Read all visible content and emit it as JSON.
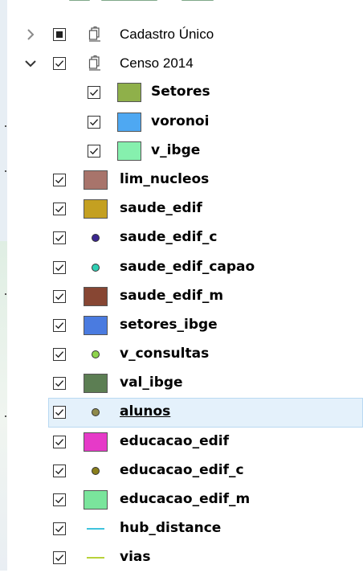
{
  "layers_panel": {
    "items": [
      {
        "kind": "group",
        "label": "Cadastro Único",
        "expanded": false,
        "checked": "partial",
        "icon": "layer-group-icon"
      },
      {
        "kind": "group",
        "label": "Censo 2014",
        "expanded": true,
        "checked": "checked",
        "icon": "layer-group-icon"
      },
      {
        "kind": "polygon",
        "label": "Setores",
        "color": "#8fb04a",
        "child": true
      },
      {
        "kind": "polygon",
        "label": "voronoi",
        "color": "#4ea8f2",
        "child": true
      },
      {
        "kind": "polygon",
        "label": "v_ibge",
        "color": "#86f0ae",
        "child": true
      },
      {
        "kind": "polygon",
        "label": "lim_nucleos",
        "color": "#a8746b"
      },
      {
        "kind": "polygon",
        "label": "saude_edif",
        "color": "#c4a021"
      },
      {
        "kind": "point",
        "label": "saude_edif_c",
        "color": "#3b2790"
      },
      {
        "kind": "point",
        "label": "saude_edif_capao",
        "color": "#2fcfb4"
      },
      {
        "kind": "polygon",
        "label": "saude_edif_m",
        "color": "#874633"
      },
      {
        "kind": "polygon",
        "label": "setores_ibge",
        "color": "#4a7be0"
      },
      {
        "kind": "point",
        "label": "v_consultas",
        "color": "#8ed44c"
      },
      {
        "kind": "polygon",
        "label": "val_ibge",
        "color": "#5c7e53"
      },
      {
        "kind": "point",
        "label": "alunos",
        "color": "#8f8a4b",
        "selected": true
      },
      {
        "kind": "polygon",
        "label": "educacao_edif",
        "color": "#e63ac8"
      },
      {
        "kind": "point",
        "label": "educacao_edif_c",
        "color": "#8a7f1c"
      },
      {
        "kind": "polygon",
        "label": "educacao_edif_m",
        "color": "#7ae59c"
      },
      {
        "kind": "line",
        "label": "hub_distance",
        "color": "#3fc3dd"
      },
      {
        "kind": "line",
        "label": "vias",
        "color": "#b8d23a"
      }
    ]
  }
}
